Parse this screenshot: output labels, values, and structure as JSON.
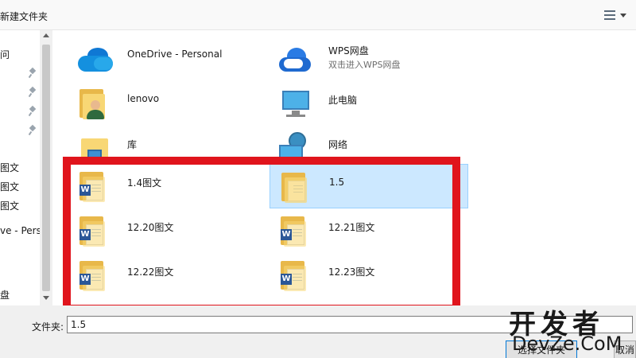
{
  "toolbar": {
    "new_folder_label": "新建文件夹",
    "view_icon": "view-options-icon"
  },
  "nav": {
    "items": [
      {
        "label": "问",
        "pinned": false
      },
      {
        "label": "",
        "pinned": true
      },
      {
        "label": "",
        "pinned": true
      },
      {
        "label": "",
        "pinned": true
      },
      {
        "label": "",
        "pinned": true
      },
      {
        "label": "图文",
        "pinned": false
      },
      {
        "label": "图文",
        "pinned": false
      },
      {
        "label": "图文",
        "pinned": false
      },
      {
        "label": "ve - Perso",
        "pinned": false
      },
      {
        "label": "盘",
        "pinned": false
      }
    ]
  },
  "content": {
    "tiles": [
      {
        "name": "OneDrive - Personal",
        "sub": "",
        "icon": "onedrive-cloud-icon"
      },
      {
        "name": "WPS网盘",
        "sub": "双击进入WPS网盘",
        "icon": "wps-cloud-icon"
      },
      {
        "name": "lenovo",
        "sub": "",
        "icon": "user-folder-icon"
      },
      {
        "name": "此电脑",
        "sub": "",
        "icon": "this-pc-icon"
      },
      {
        "name": "库",
        "sub": "",
        "icon": "library-icon"
      },
      {
        "name": "网络",
        "sub": "",
        "icon": "network-icon"
      },
      {
        "name": "1.4图文",
        "sub": "",
        "icon": "word-folder-icon"
      },
      {
        "name": "1.5",
        "sub": "",
        "icon": "folder-icon",
        "selected": true
      },
      {
        "name": "12.20图文",
        "sub": "",
        "icon": "word-folder-icon"
      },
      {
        "name": "12.21图文",
        "sub": "",
        "icon": "word-folder-icon"
      },
      {
        "name": "12.22图文",
        "sub": "",
        "icon": "word-folder-icon"
      },
      {
        "name": "12.23图文",
        "sub": "",
        "icon": "word-folder-icon"
      }
    ]
  },
  "bottom": {
    "filename_label": "文件夹:",
    "filename_value": "1.5",
    "select_button": "选择文件夹",
    "cancel_button": "取消"
  },
  "watermark": {
    "line1": "开发者",
    "line2": "DevZe.CoM"
  },
  "colors": {
    "highlight": "#e0141c",
    "selected_bg": "#cce8ff",
    "folder": "#f8d775"
  }
}
